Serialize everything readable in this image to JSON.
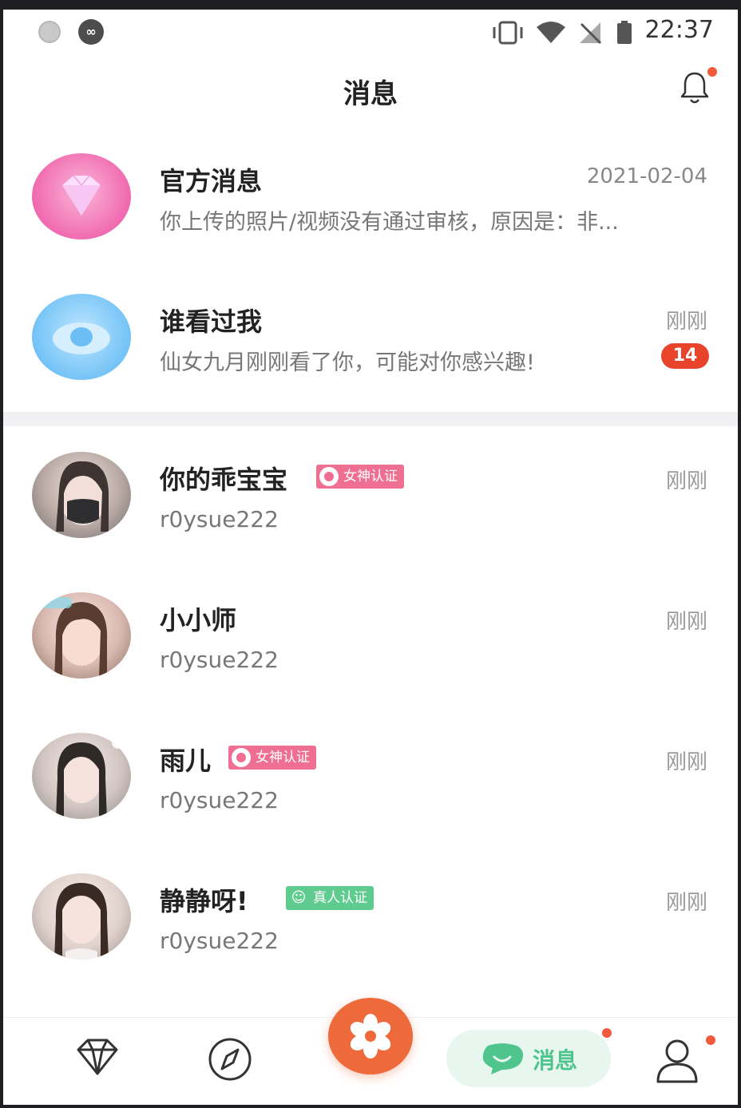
{
  "status_bar": {
    "time": "22:37"
  },
  "header": {
    "title": "消息"
  },
  "system_items": [
    {
      "name": "官方消息",
      "preview": "你上传的照片/视频没有通过审核，原因是：非...",
      "time": "2021-02-04",
      "unread": ""
    },
    {
      "name": "谁看过我",
      "preview": "仙女九月刚刚看了你，可能对你感兴趣!",
      "time": "刚刚",
      "unread": "14"
    }
  ],
  "conversations": [
    {
      "name": "你的乖宝宝",
      "tag": "女神认证",
      "tag_type": "pink",
      "preview": "r0ysue222",
      "time": "刚刚"
    },
    {
      "name": "小小师",
      "tag": "",
      "tag_type": "",
      "preview": "r0ysue222",
      "time": "刚刚"
    },
    {
      "name": "雨儿",
      "tag": "女神认证",
      "tag_type": "pink",
      "preview": "r0ysue222",
      "time": "刚刚"
    },
    {
      "name": "静静呀!",
      "tag": "真人认证",
      "tag_type": "green",
      "preview": "r0ysue222",
      "time": "刚刚"
    }
  ],
  "tab_bar": {
    "items": [
      {
        "icon": "diamond-icon",
        "label": ""
      },
      {
        "icon": "compass-icon",
        "label": ""
      },
      {
        "icon": "flower-icon",
        "label": ""
      },
      {
        "icon": "chat-bubble-icon",
        "label": "消息"
      },
      {
        "icon": "person-icon",
        "label": ""
      }
    ]
  },
  "colors": {
    "accent": "#ef6a3a",
    "unread_badge": "#e8442c",
    "goddess_tag": "#ef6f93",
    "real_person_tag": "#5fcb8f",
    "active_tab": "#4fc48d"
  }
}
